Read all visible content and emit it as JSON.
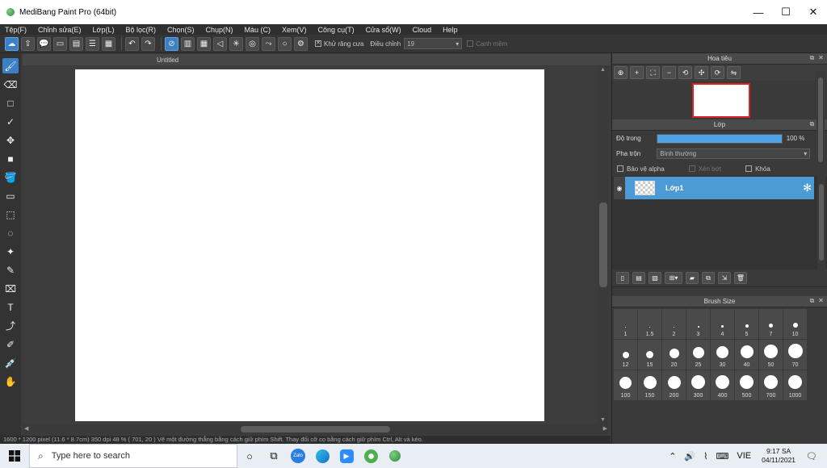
{
  "window": {
    "title": "MediBang Paint Pro (64bit)",
    "min": "—",
    "max": "☐",
    "close": "✕"
  },
  "menu": [
    "Tệp(F)",
    "Chỉnh sửa(E)",
    "Lớp(L)",
    "Bộ lọc(R)",
    "Chọn(S)",
    "Chụp(N)",
    "Màu (C)",
    "Xem(V)",
    "Công cụ(T)",
    "Cửa sổ(W)",
    "Cloud",
    "Help"
  ],
  "toolbar": {
    "antialias_label": "Khử răng cưa",
    "antialias_checked": "✕",
    "adjust_label": "Điều chỉnh",
    "adjust_value": "19",
    "soft_edge_label": "Cạnh mềm"
  },
  "document": {
    "tab_title": "Untitled"
  },
  "status": {
    "text": "1600 * 1200 pixel   (11.6 * 8.7cm)   350 dpi   48 %   ( 701, 20 )   Vẽ một đường thẳng bằng cách giữ phím Shift. Thay đổi cỡ cọ bằng cách giữ phím Ctrl, Alt và kéo."
  },
  "navigator": {
    "title": "Hoa tiêu"
  },
  "layer_panel": {
    "title": "Lớp",
    "opacity_label": "Độ trong",
    "opacity_value": "100 %",
    "opacity_fraction": 1.0,
    "blend_label": "Pha trộn",
    "blend_value": "Bình thường",
    "protect_alpha": "Bảo vệ alpha",
    "clipping": "Xén bớt",
    "lock": "Khóa",
    "layers": [
      {
        "name": "Lớp1"
      }
    ]
  },
  "brush_size": {
    "title": "Brush Size",
    "sizes": [
      "1",
      "1.5",
      "2",
      "3",
      "4",
      "5",
      "7",
      "10",
      "12",
      "15",
      "20",
      "25",
      "30",
      "40",
      "50",
      "70",
      "100",
      "150",
      "200",
      "300",
      "400",
      "500",
      "700",
      "1000"
    ]
  },
  "taskbar": {
    "search_placeholder": "Type here to search",
    "language": "VIE",
    "time": "9:17 SA",
    "date": "04/11/2021"
  },
  "colors": {
    "accent": "#3b7fc4",
    "layer_selected": "#4c9ad6",
    "opacity_fill": "#4da3e6",
    "nav_frame": "#e02020"
  }
}
